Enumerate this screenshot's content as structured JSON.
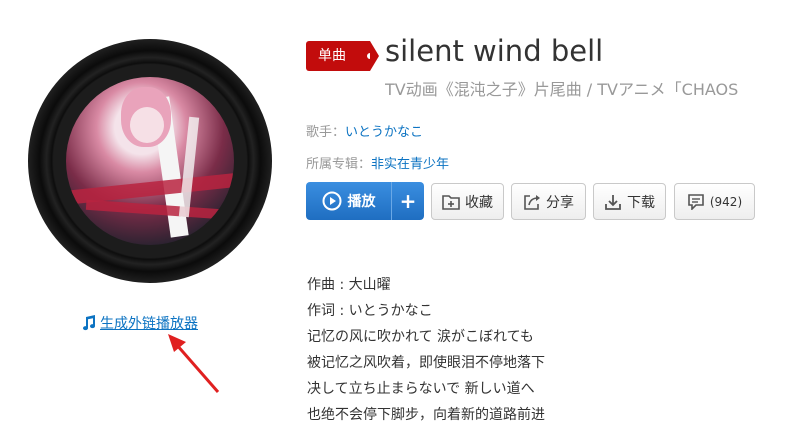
{
  "song": {
    "badge": "单曲",
    "title": "silent wind bell",
    "subtitle": "TV动画《混沌之子》片尾曲 / TVアニメ「CHAOS"
  },
  "meta": {
    "singer_label": "歌手：",
    "singer": "いとうかなこ",
    "album_label": "所属专辑：",
    "album": "非实在青少年"
  },
  "actions": {
    "play": "播放",
    "add": "+",
    "collect": "收藏",
    "share": "分享",
    "download": "下载",
    "comments": "(942)"
  },
  "external_player": "生成外链播放器",
  "lyrics": [
    "作曲 : 大山曜",
    "作词 : いとうかなこ",
    "记忆の风に吹かれて 涙がこぼれても",
    "被记忆之风吹着，即使眼泪不停地落下",
    "决して立ち止まらないで 新しい道へ",
    "也绝不会停下脚步，向着新的道路前进"
  ],
  "colors": {
    "badge_red": "#c20c0c",
    "link_blue": "#0c73c2",
    "play_blue": "#2a7fd4",
    "arrow_red": "#e02020"
  }
}
